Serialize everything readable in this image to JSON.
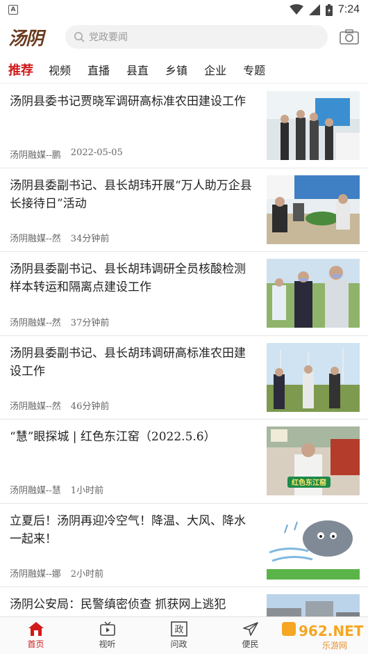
{
  "status": {
    "time": "7:24",
    "left_icon": "app-a-icon"
  },
  "header": {
    "logo": "汤阴",
    "search_placeholder": "党政要闻",
    "camera_icon": "camera-icon"
  },
  "tabs": [
    {
      "label": "推荐",
      "active": true
    },
    {
      "label": "视频"
    },
    {
      "label": "直播"
    },
    {
      "label": "县直"
    },
    {
      "label": "乡镇"
    },
    {
      "label": "企业"
    },
    {
      "label": "专题"
    }
  ],
  "news": [
    {
      "title": "汤阴县委书记贾晓军调研高标准农田建设工作",
      "source": "汤阴融媒--鹏",
      "time": "2022-05-05"
    },
    {
      "title": "汤阴县委副书记、县长胡玮开展“万人助万企县长接待日”活动",
      "source": "汤阴融媒--然",
      "time": "34分钟前"
    },
    {
      "title": "汤阴县委副书记、县长胡玮调研全员核酸检测样本转运和隔离点建设工作",
      "source": "汤阴融媒--然",
      "time": "37分钟前"
    },
    {
      "title": "汤阴县委副书记、县长胡玮调研高标准农田建设工作",
      "source": "汤阴融媒--然",
      "time": "46分钟前"
    },
    {
      "title": "“慧”眼探城 | 红色东江窑（2022.5.6）",
      "source": "汤阴融媒--慧",
      "time": "1小时前",
      "thumb_caption": "红色东江窑"
    },
    {
      "title": "立夏后！汤阴再迎冷空气！降温、大风、降水一起来！",
      "source": "汤阴融媒--娜",
      "time": "2小时前"
    },
    {
      "title": "汤阴公安局：民警缜密侦查 抓获网上逃犯",
      "source": "",
      "time": ""
    }
  ],
  "bottom_nav": [
    {
      "label": "首页",
      "icon": "home-icon",
      "active": true
    },
    {
      "label": "视听",
      "icon": "tv-icon"
    },
    {
      "label": "问政",
      "icon": "zheng-icon",
      "glyph": "政"
    },
    {
      "label": "便民",
      "icon": "send-icon"
    }
  ],
  "watermark": {
    "text": "962.NET",
    "sub": "乐游网"
  },
  "colors": {
    "accent": "#d11a1a",
    "logo": "#6b3a1f"
  }
}
